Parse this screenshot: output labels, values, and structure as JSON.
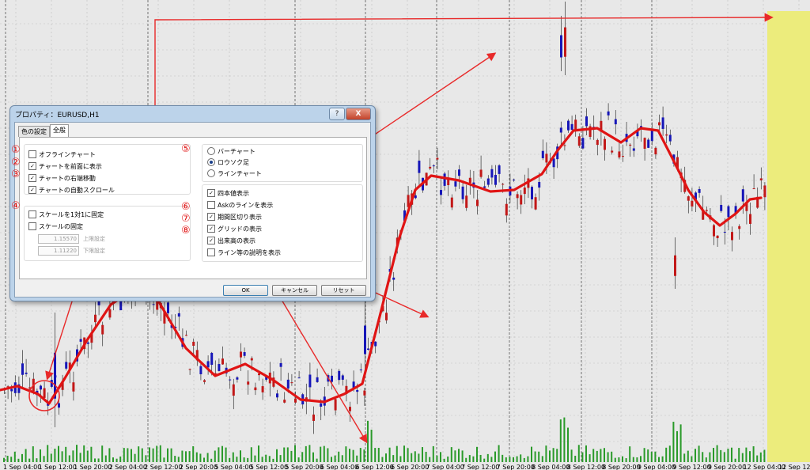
{
  "dialog": {
    "title": "プロパティ：EURUSD,H1",
    "help": "?",
    "close": "X",
    "tabs": [
      {
        "label": "色の設定",
        "active": false
      },
      {
        "label": "全般",
        "active": true
      }
    ],
    "left_options": [
      {
        "label": "オフラインチャート",
        "checked": false
      },
      {
        "label": "チャートを前面に表示",
        "checked": true
      },
      {
        "label": "チャートの右端移動",
        "checked": true
      },
      {
        "label": "チャートの自動スクロール",
        "checked": true
      }
    ],
    "scale_options": [
      {
        "label": "スケールを1対1に固定",
        "checked": false
      },
      {
        "label": "スケールの固定",
        "checked": false
      }
    ],
    "upper_value": "1.15570",
    "upper_label": "上限設定",
    "lower_value": "1.11220",
    "lower_label": "下限設定",
    "chart_types": [
      {
        "label": "バーチャート",
        "selected": false
      },
      {
        "label": "ロウソク足",
        "selected": true
      },
      {
        "label": "ラインチャート",
        "selected": false
      }
    ],
    "display_options": [
      {
        "label": "四本値表示",
        "checked": true
      },
      {
        "label": "Askのラインを表示",
        "checked": false
      },
      {
        "label": "期間区切り表示",
        "checked": true
      },
      {
        "label": "グリッドの表示",
        "checked": true
      },
      {
        "label": "出来高の表示",
        "checked": true
      },
      {
        "label": "ライン等の説明を表示",
        "checked": false
      }
    ],
    "buttons": {
      "ok": "OK",
      "cancel": "キャンセル",
      "reset": "リセット"
    }
  },
  "annotations": [
    "①",
    "②",
    "③",
    "④",
    "⑤",
    "⑥",
    "⑦",
    "⑧"
  ],
  "chart": {
    "symbol": "EURUSD",
    "timeframe": "H1",
    "x_labels": [
      "1 Sep 04:00",
      "1 Sep 12:00",
      "1 Sep 20:00",
      "2 Sep 04:00",
      "2 Sep 12:00",
      "2 Sep 20:00",
      "5 Sep 04:00",
      "5 Sep 12:00",
      "5 Sep 20:00",
      "6 Sep 04:00",
      "6 Sep 12:00",
      "6 Sep 20:00",
      "7 Sep 04:00",
      "7 Sep 12:00",
      "7 Sep 20:00",
      "8 Sep 04:00",
      "8 Sep 12:00",
      "8 Sep 20:00",
      "9 Sep 04:00",
      "9 Sep 12:00",
      "9 Sep 20:00",
      "12 Sep 04:00",
      "12 Sep 12:00"
    ],
    "colors": {
      "background": "#e8e8e8",
      "bull": "#1616b8",
      "bear": "#c21818",
      "ma": "#e01414",
      "volume": "#2a9a2a",
      "shift_area": "#ecec7c",
      "arrow": "#e82a2a"
    }
  }
}
